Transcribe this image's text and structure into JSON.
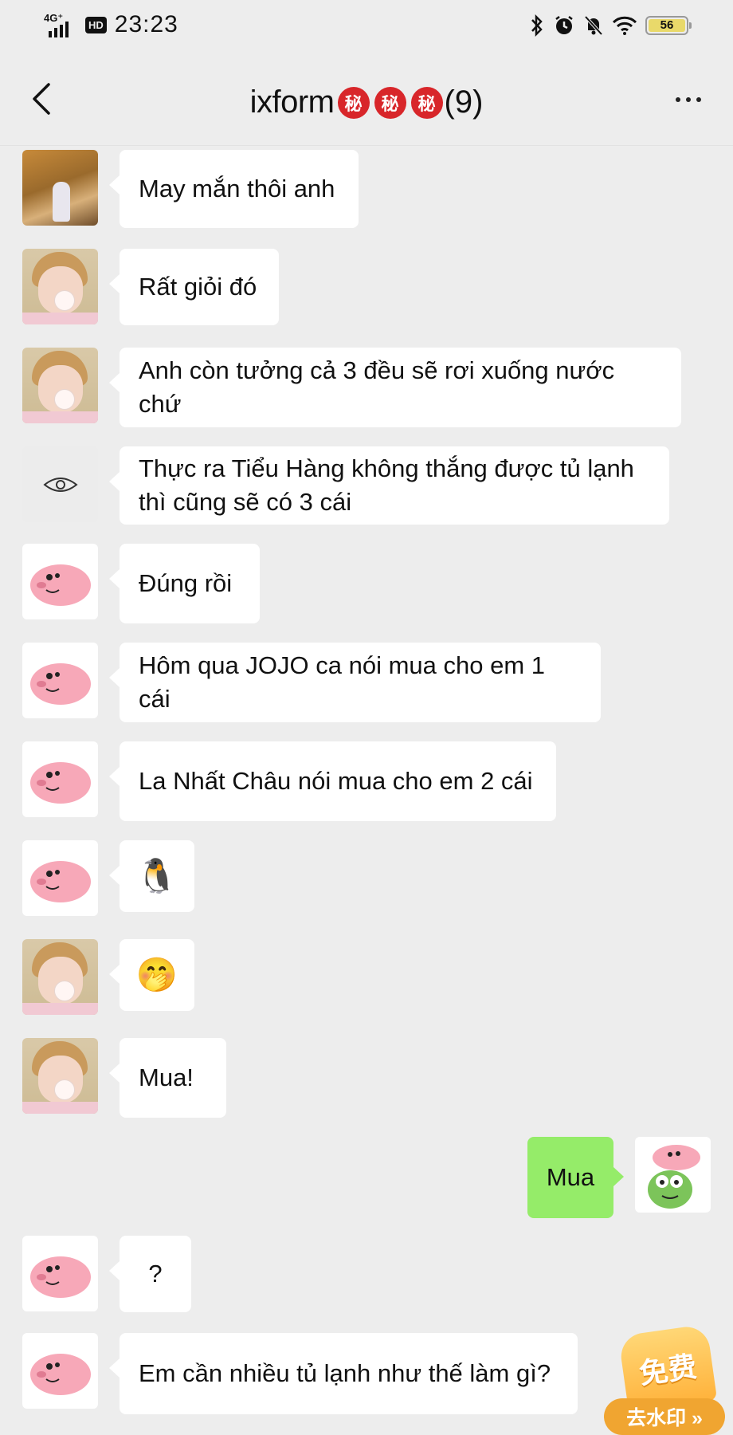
{
  "status_bar": {
    "network": "4G⁺",
    "hd": "HD",
    "time": "23:23",
    "battery": "56",
    "icons": [
      "bluetooth-icon",
      "alarm-icon",
      "mute-bell-icon",
      "wifi-icon",
      "battery-icon"
    ]
  },
  "header": {
    "title": "ixform",
    "badges": [
      "秘",
      "秘",
      "秘"
    ],
    "member_count": "(9)"
  },
  "messages": [
    {
      "side": "left",
      "avatar": "autumn-photo",
      "text": "May mắn thôi anh"
    },
    {
      "side": "left",
      "avatar": "boy-bubblegum",
      "text": "Rất giỏi đó"
    },
    {
      "side": "left",
      "avatar": "boy-bubblegum",
      "text": "Anh còn tưởng cả 3 đều sẽ rơi xuống nước chứ"
    },
    {
      "side": "left",
      "avatar": "eye-drawing",
      "text": "Thực ra Tiểu Hàng không thắng được tủ lạnh\nthì cũng sẽ có 3 cái"
    },
    {
      "side": "left",
      "avatar": "pink-pig",
      "text": "Đúng rồi"
    },
    {
      "side": "left",
      "avatar": "pink-pig",
      "text": "Hôm qua JOJO ca nói mua cho em 1 cái"
    },
    {
      "side": "left",
      "avatar": "pink-pig",
      "text": "La Nhất Châu nói mua cho em 2 cái"
    },
    {
      "side": "left",
      "avatar": "pink-pig",
      "emoji": "🐧"
    },
    {
      "side": "left",
      "avatar": "boy-bubblegum",
      "emoji": "🤭"
    },
    {
      "side": "left",
      "avatar": "boy-bubblegum",
      "text": "Mua!"
    },
    {
      "side": "right",
      "avatar": "pig-frog-sticker",
      "text": "Mua"
    },
    {
      "side": "left",
      "avatar": "pink-pig",
      "text": "?"
    },
    {
      "side": "left",
      "avatar": "pink-pig",
      "text": "Em cần nhiều tủ lạnh như thế làm gì?"
    }
  ],
  "promo": {
    "top": "免费",
    "bottom": "去水印 »"
  },
  "colors": {
    "background": "#ededed",
    "bubble_left": "#ffffff",
    "bubble_right": "#95ec69",
    "badge": "#d8262a"
  }
}
